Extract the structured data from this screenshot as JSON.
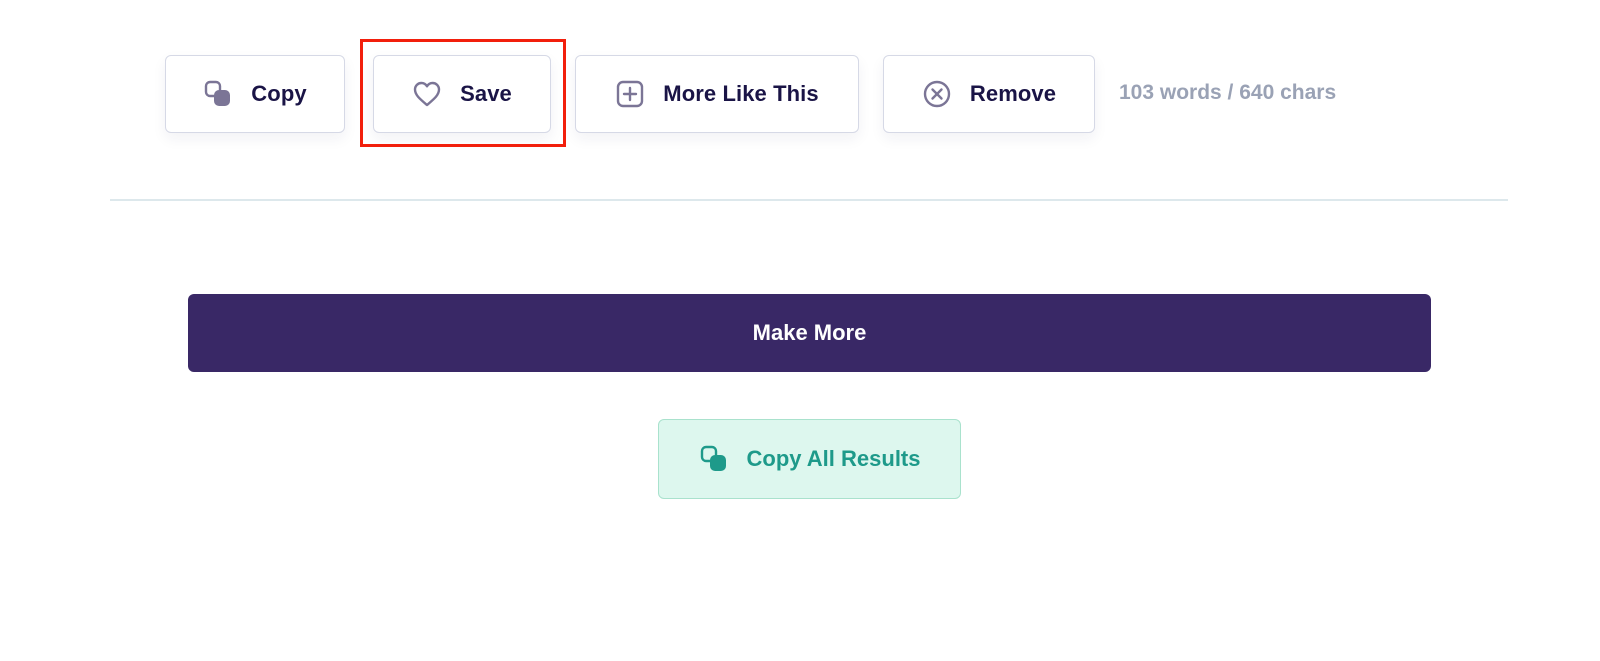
{
  "toolbar": {
    "copy_label": "Copy",
    "save_label": "Save",
    "more_like_this_label": "More Like This",
    "remove_label": "Remove",
    "stats": "103 words / 640 chars"
  },
  "actions": {
    "make_more_label": "Make More",
    "copy_all_label": "Copy All Results"
  },
  "icons": {
    "copy": "copy-icon",
    "save": "heart-icon",
    "more_like_this": "plus-square-icon",
    "remove": "close-circle-icon",
    "copy_all": "copy-icon"
  },
  "colors": {
    "primary": "#392866",
    "icon_gray": "#7b7596",
    "text_dark": "#1a1446",
    "muted_text": "#9aa2b5",
    "success_bg": "#ddf7ee",
    "success_text": "#1e9a8a",
    "highlight": "#f21f0c"
  }
}
